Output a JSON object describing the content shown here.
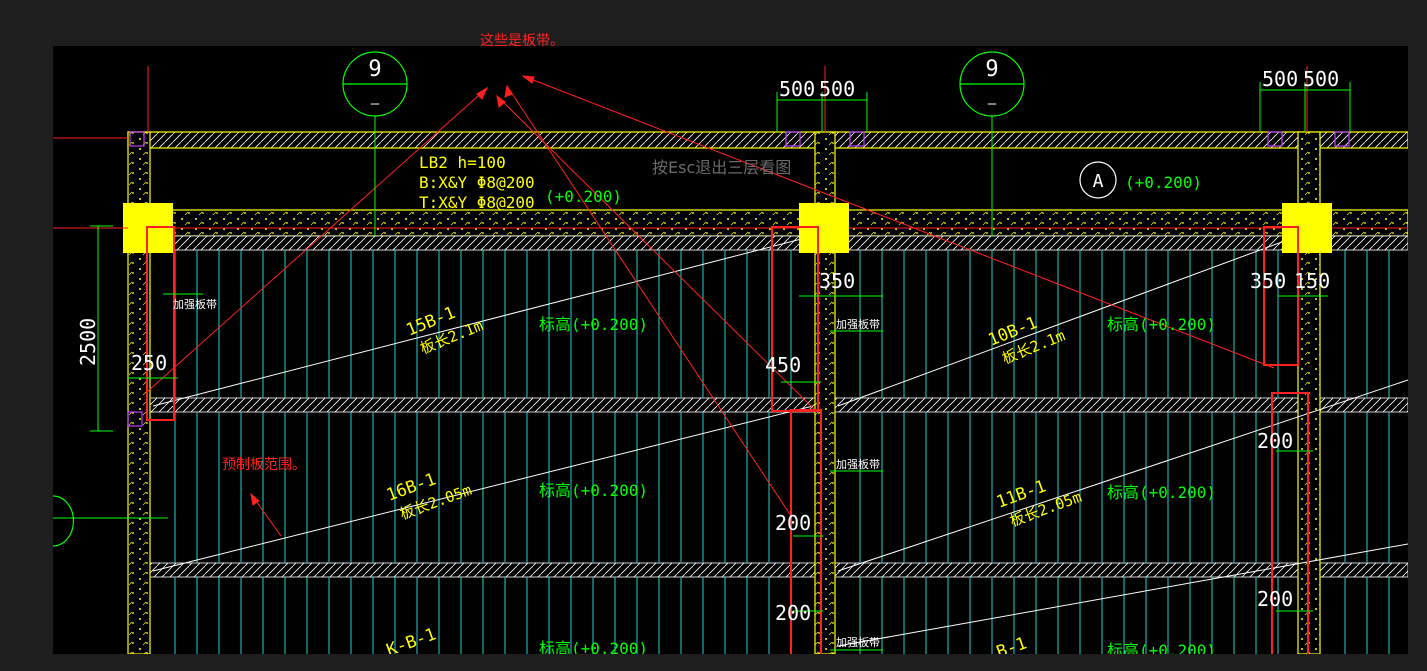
{
  "annotations": {
    "top_note": "这些是板带。",
    "left_note": "预制板范围。",
    "hint": "按Esc退出三层看图"
  },
  "drawing": {
    "axis_bubbles": [
      {
        "top": "9",
        "bottom": "—"
      },
      {
        "top": "9",
        "bottom": "—"
      }
    ],
    "grid_circle": "A",
    "slab_note": {
      "line1": "LB2  h=100",
      "line2": "B:X&Y Φ8@200",
      "line3": "T:X&Y Φ8@200",
      "elev": "(+0.200)"
    },
    "elev_A": "(+0.200)",
    "dims": {
      "top_mid_left": "500",
      "top_mid_right": "500",
      "top_right_left": "500",
      "top_right_right": "500",
      "left_vertical": "2500",
      "left_250": "250",
      "mid_350": "350",
      "mid_450": "450",
      "right_350": "350",
      "right_150": "150",
      "mid_200a": "200",
      "mid_200b": "200",
      "right_200a": "200",
      "right_200b": "200"
    },
    "tags": {
      "tag1": "加强板带",
      "tag2": "加强板带",
      "tag3": "加强板带",
      "tag4": "加强板带"
    },
    "panels": [
      {
        "name": "15B-1",
        "len": "板长2.1m",
        "elev": "标高(+0.200)"
      },
      {
        "name": "10B-1",
        "len": "板长2.1m",
        "elev": "标高(+0.200)"
      },
      {
        "name": "16B-1",
        "len": "板长2.05m",
        "elev": "标高(+0.200)"
      },
      {
        "name": "11B-1",
        "len": "板长2.05m",
        "elev": "标高(+0.200)"
      },
      {
        "name": "K-B-1",
        "len": "",
        "elev": "标高(+0.200)"
      },
      {
        "name": "B-1",
        "len": "",
        "elev": "标高(+0.200)"
      }
    ]
  },
  "colors": {
    "background": "#000000",
    "wall": "#ffff00",
    "column": "#ffff00",
    "slab_lines": "#20d0d0",
    "dimension": "#00ff00",
    "annotation": "#ff2020",
    "diagonal": "#ffffff",
    "magenta": "#c040ff"
  }
}
